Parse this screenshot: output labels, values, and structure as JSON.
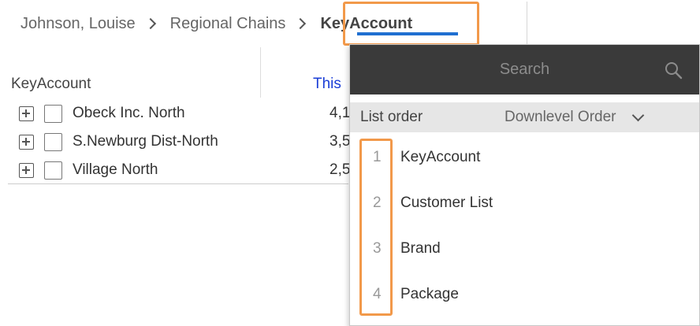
{
  "breadcrumb": {
    "items": [
      "Johnson, Louise",
      "Regional Chains"
    ],
    "current": "KeyAccount"
  },
  "table": {
    "headers": {
      "keyaccount": "KeyAccount",
      "this": "This"
    },
    "rows": [
      {
        "name": "Obeck Inc. North",
        "value": "4,1"
      },
      {
        "name": "S.Newburg Dist-North",
        "value": "3,5"
      },
      {
        "name": "Village North",
        "value": "2,5"
      }
    ]
  },
  "panel": {
    "search_placeholder": "Search",
    "list_order_label": "List order",
    "list_order_value": "Downlevel Order",
    "items": [
      {
        "num": "1",
        "label": "KeyAccount"
      },
      {
        "num": "2",
        "label": "Customer List"
      },
      {
        "num": "3",
        "label": "Brand"
      },
      {
        "num": "4",
        "label": "Package"
      }
    ]
  },
  "colors": {
    "highlight": "#f2994a",
    "accent": "#1f6fd1",
    "header_link": "#1a3dd6",
    "panel_header": "#3a3a3a"
  }
}
